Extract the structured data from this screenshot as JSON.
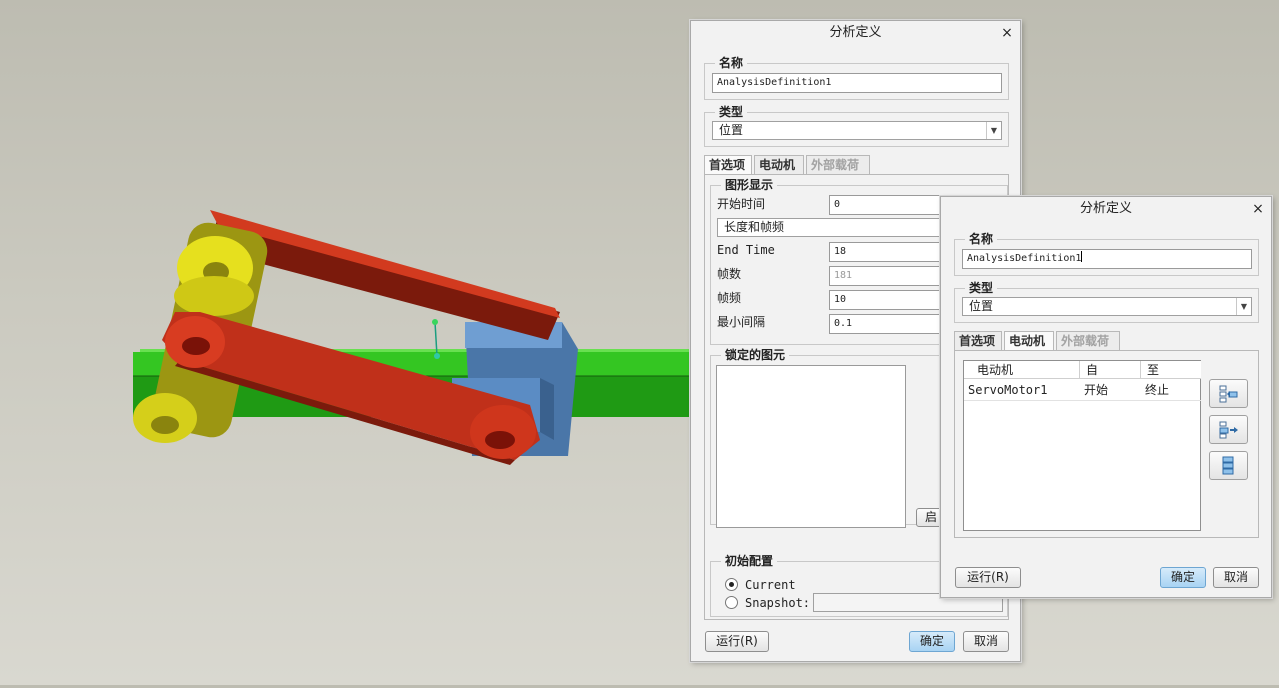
{
  "colors": {
    "link_red": "#c0301a",
    "link_yellow": "#d5cf1a",
    "base_green": "#2fbd1e",
    "slider_blue": "#5b8cc4",
    "primary_button": "#a8d3f3"
  },
  "back_dialog": {
    "title": "分析定义",
    "close_glyph": "×",
    "name_label": "名称",
    "name_value": "AnalysisDefinition1",
    "type_label": "类型",
    "type_value": "位置",
    "tabs": [
      "首选项",
      "电动机",
      "外部载荷"
    ],
    "graph_display_label": "图形显示",
    "start_time_label": "开始时间",
    "start_time_value": "0",
    "mode_value": "长度和帧频",
    "end_time_label": "End Time",
    "end_time_value": "18",
    "frames_label": "帧数",
    "frames_value": "181",
    "frame_rate_label": "帧频",
    "frame_rate_value": "10",
    "min_interval_label": "最小间隔",
    "min_interval_value": "0.1",
    "locked_entities_label": "锁定的图元",
    "enable_button_fragment": "启",
    "initial_config_label": "初始配置",
    "current_label": "Current",
    "snapshot_label": "Snapshot:",
    "run_button": "运行(R)",
    "ok_button": "确定",
    "cancel_button": "取消"
  },
  "front_dialog": {
    "title": "分析定义",
    "close_glyph": "×",
    "name_label": "名称",
    "name_value": "AnalysisDefinition1",
    "type_label": "类型",
    "type_value": "位置",
    "tabs": [
      "首选项",
      "电动机",
      "外部载荷"
    ],
    "motor_table": {
      "headers": [
        "电动机",
        "自",
        "至"
      ],
      "rows": [
        [
          "ServoMotor1",
          "开始",
          "终止"
        ]
      ]
    },
    "run_button": "运行(R)",
    "ok_button": "确定",
    "cancel_button": "取消"
  }
}
